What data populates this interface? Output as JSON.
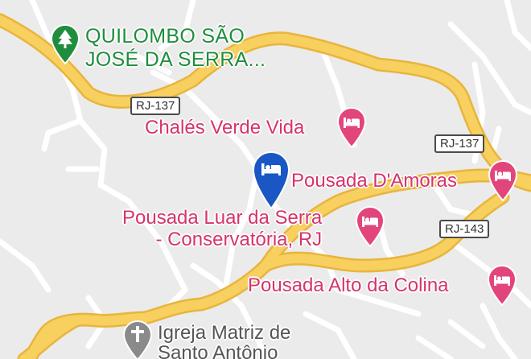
{
  "map": {
    "colors": {
      "land": "#ebebeb",
      "highway": "#f7d060",
      "highway_casing": "#e8b53c",
      "local_road": "#ffffff",
      "lodging_pin": "#e2457c",
      "selected_pin": "#1a56c4",
      "park_green": "#1e8e3e",
      "church_pin": "#8a8a8a"
    },
    "places": {
      "quilombo": {
        "line1": "QUILOMBO SÃO",
        "line2": "JOSÉ DA SERRA...",
        "icon": "tree-icon"
      },
      "chales": {
        "label": "Chalés Verde Vida",
        "icon": "bed-icon"
      },
      "damoras": {
        "label": "Pousada D'Amoras",
        "icon": "bed-icon"
      },
      "luar": {
        "line1": "Pousada Luar da Serra",
        "line2": "- Conservatória, RJ",
        "icon": "bed-icon"
      },
      "alto": {
        "label": "Pousada Alto da Colina",
        "icon": "bed-icon"
      },
      "igreja": {
        "line1": "Igreja Matriz de",
        "line2": "Santo Antônio",
        "icon": "cross-icon"
      },
      "selected": {
        "icon": "bed-icon"
      }
    },
    "road_shields": {
      "rj137_a": "RJ-137",
      "rj137_b": "RJ-137",
      "rj143": "RJ-143"
    }
  }
}
